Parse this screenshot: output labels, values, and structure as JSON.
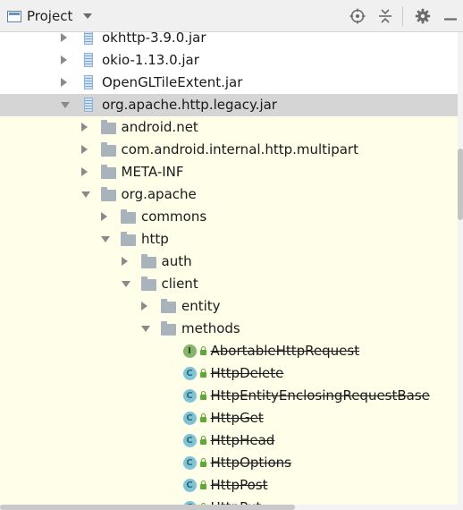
{
  "toolbar": {
    "title": "Project",
    "icons": [
      "window-icon",
      "chevron-down-icon",
      "locate-icon",
      "collapse-all-icon",
      "gear-icon",
      "hide-icon"
    ]
  },
  "tree": [
    {
      "label": "okhttp-3.9.0.jar",
      "icon": "jar-icon",
      "toggle": "collapsed",
      "depth": 0
    },
    {
      "label": "okio-1.13.0.jar",
      "icon": "jar-icon",
      "toggle": "collapsed",
      "depth": 0
    },
    {
      "label": "OpenGLTileExtent.jar",
      "icon": "jar-icon",
      "toggle": "collapsed",
      "depth": 0
    },
    {
      "label": "org.apache.http.legacy.jar",
      "icon": "jar-icon",
      "toggle": "expanded",
      "depth": 0,
      "selected": true
    },
    {
      "label": "android.net",
      "icon": "folder-icon",
      "toggle": "collapsed",
      "depth": 1
    },
    {
      "label": "com.android.internal.http.multipart",
      "icon": "folder-icon",
      "toggle": "collapsed",
      "depth": 1
    },
    {
      "label": "META-INF",
      "icon": "folder-icon",
      "toggle": "collapsed",
      "depth": 1
    },
    {
      "label": "org.apache",
      "icon": "folder-icon",
      "toggle": "expanded",
      "depth": 1
    },
    {
      "label": "commons",
      "icon": "folder-icon",
      "toggle": "collapsed",
      "depth": 2
    },
    {
      "label": "http",
      "icon": "folder-icon",
      "toggle": "expanded",
      "depth": 2
    },
    {
      "label": "auth",
      "icon": "folder-icon",
      "toggle": "collapsed",
      "depth": 3
    },
    {
      "label": "client",
      "icon": "folder-icon",
      "toggle": "expanded",
      "depth": 3
    },
    {
      "label": "entity",
      "icon": "folder-icon",
      "toggle": "collapsed",
      "depth": 4
    },
    {
      "label": "methods",
      "icon": "folder-icon",
      "toggle": "expanded",
      "depth": 4
    },
    {
      "label": "AbortableHttpRequest",
      "icon": "interface-icon",
      "badge": "I",
      "depth": 5,
      "deprecated": true
    },
    {
      "label": "HttpDelete",
      "icon": "class-icon",
      "badge": "C",
      "depth": 5,
      "deprecated": true
    },
    {
      "label": "HttpEntityEnclosingRequestBase",
      "icon": "class-icon",
      "badge": "C",
      "depth": 5,
      "deprecated": true
    },
    {
      "label": "HttpGet",
      "icon": "class-icon",
      "badge": "C",
      "depth": 5,
      "deprecated": true
    },
    {
      "label": "HttpHead",
      "icon": "class-icon",
      "badge": "C",
      "depth": 5,
      "deprecated": true
    },
    {
      "label": "HttpOptions",
      "icon": "class-icon",
      "badge": "C",
      "depth": 5,
      "deprecated": true
    },
    {
      "label": "HttpPost",
      "icon": "class-icon",
      "badge": "C",
      "depth": 5,
      "deprecated": true
    },
    {
      "label": "HttpPut",
      "icon": "class-icon",
      "badge": "C",
      "depth": 5,
      "deprecated": true
    }
  ],
  "colors": {
    "selection": "#d5d5d5",
    "tint": "#fefee9",
    "class_badge": "#7fc4d4",
    "interface_badge": "#85b56a",
    "lock": "#5da935"
  }
}
